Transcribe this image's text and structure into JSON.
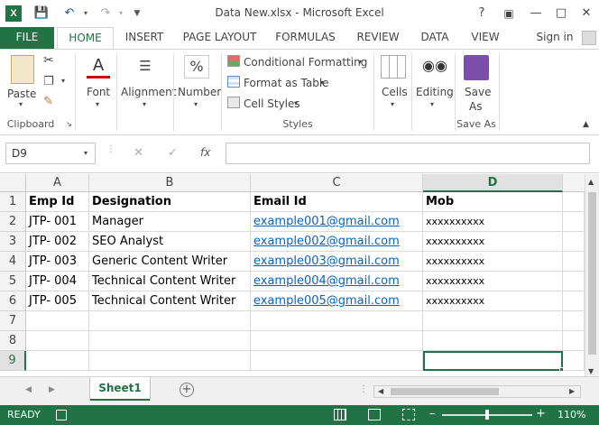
{
  "window": {
    "title": "Data New.xlsx - Microsoft Excel",
    "help": "?",
    "sign_in": "Sign in"
  },
  "tabs": [
    "FILE",
    "HOME",
    "INSERT",
    "PAGE LAYOUT",
    "FORMULAS",
    "REVIEW",
    "DATA",
    "VIEW"
  ],
  "ribbon": {
    "clipboard": {
      "paste": "Paste",
      "label": "Clipboard"
    },
    "font": "Font",
    "alignment": "Alignment",
    "number": "Number",
    "styles": {
      "conditional": "Conditional Formatting",
      "format_table": "Format as Table",
      "cell_styles": "Cell Styles",
      "label": "Styles"
    },
    "cells": "Cells",
    "editing": "Editing",
    "save_as": {
      "line1": "Save",
      "line2": "As",
      "label": "Save As"
    }
  },
  "formula_bar": {
    "name_box": "D9",
    "fx": "fx",
    "formula": ""
  },
  "columns": [
    "A",
    "B",
    "C",
    "D"
  ],
  "rows": [
    {
      "num": "1",
      "a": "Emp Id",
      "b": "Designation",
      "c": "Email Id",
      "d": "Mob"
    },
    {
      "num": "2",
      "a": "JTP- 001",
      "b": "Manager",
      "c": "example001@gmail.com",
      "d": "xxxxxxxxxx"
    },
    {
      "num": "3",
      "a": "JTP- 002",
      "b": "SEO Analyst",
      "c": "example002@gmail.com",
      "d": "xxxxxxxxxx"
    },
    {
      "num": "4",
      "a": "JTP- 003",
      "b": "Generic Content Writer",
      "c": "example003@gmail.com",
      "d": "xxxxxxxxxx"
    },
    {
      "num": "5",
      "a": "JTP- 004",
      "b": "Technical Content Writer",
      "c": "example004@gmail.com",
      "d": "xxxxxxxxxx"
    },
    {
      "num": "6",
      "a": "JTP- 005",
      "b": "Technical Content Writer",
      "c": "example005@gmail.com",
      "d": "xxxxxxxxxx"
    },
    {
      "num": "7",
      "a": "",
      "b": "",
      "c": "",
      "d": ""
    },
    {
      "num": "8",
      "a": "",
      "b": "",
      "c": "",
      "d": ""
    },
    {
      "num": "9",
      "a": "",
      "b": "",
      "c": "",
      "d": ""
    }
  ],
  "sheet_tab": "Sheet1",
  "status": {
    "ready": "READY",
    "zoom": "110%"
  },
  "colors": {
    "accent": "#217346",
    "link": "#0563c1"
  }
}
